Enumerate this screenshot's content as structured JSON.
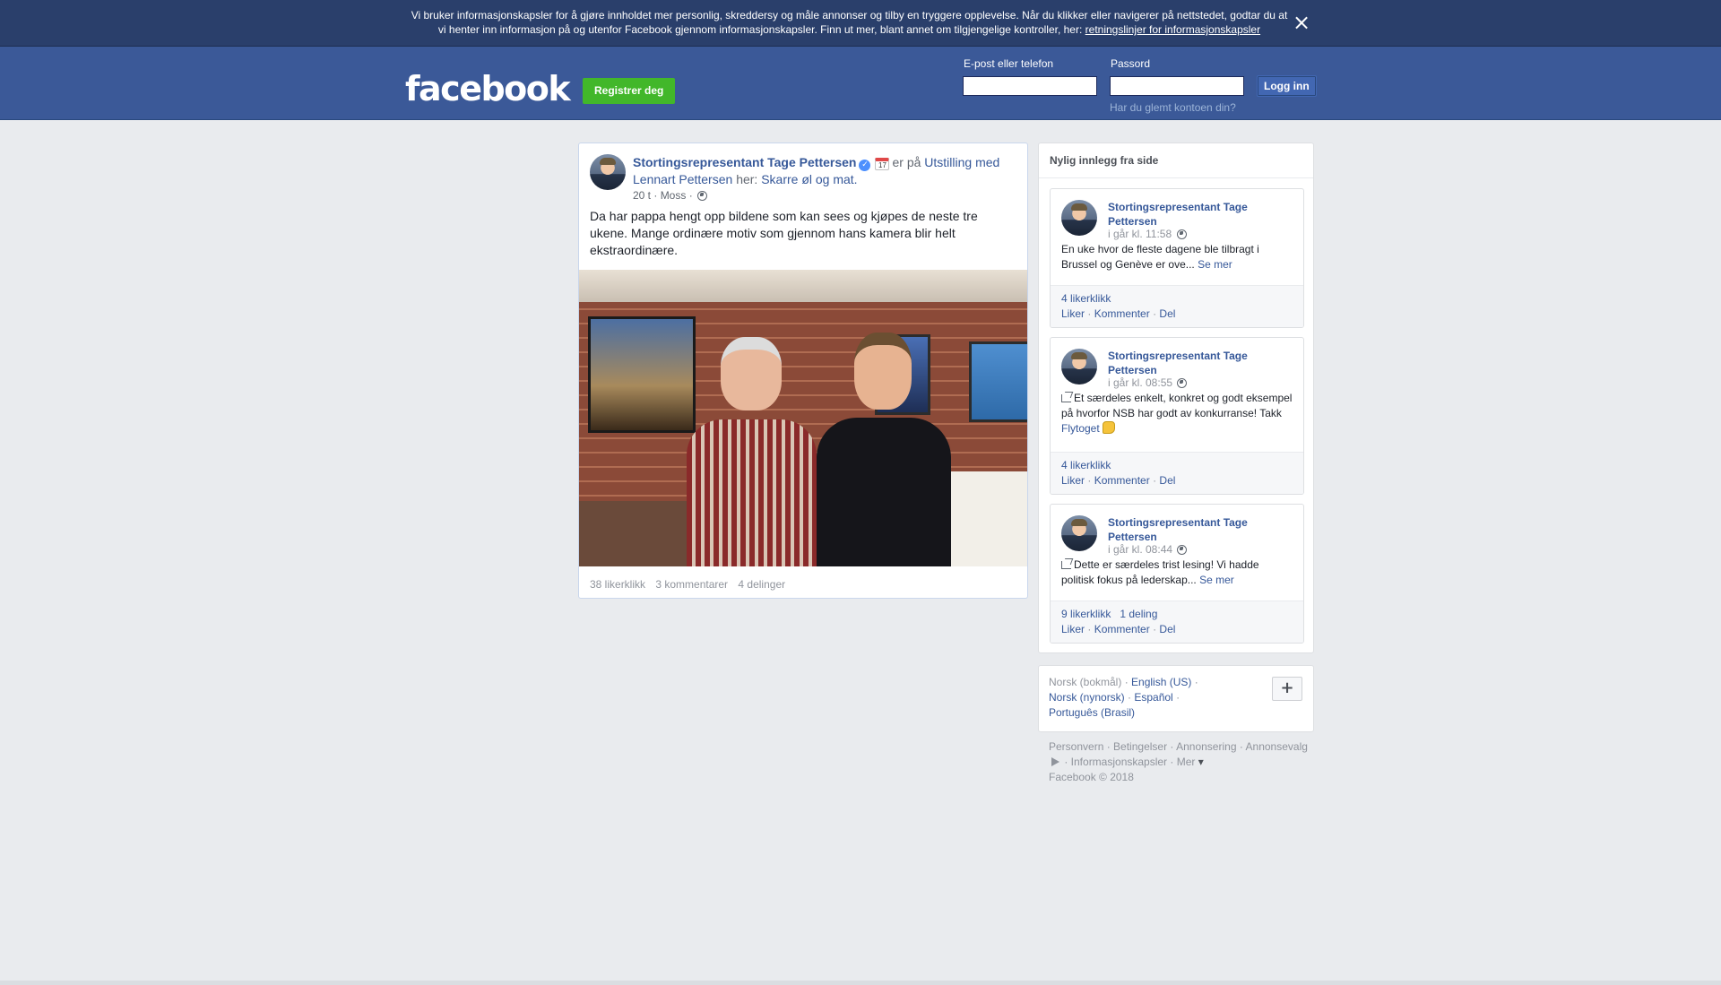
{
  "cookie_banner": {
    "text": "Vi bruker informasjonskapsler for å gjøre innholdet mer personlig, skreddersy og måle annonser og tilby en tryggere opplevelse. Når du klikker eller navigerer på nettstedet, godtar du at vi henter inn informasjon på og utenfor Facebook gjennom informasjonskapsler. Finn ut mer, blant annet om tilgjengelige kontroller, her: ",
    "link": "retningslinjer for informasjonskapsler",
    "close_icon": "close-icon"
  },
  "header": {
    "logo": "facebook",
    "register_label": "Registrer deg",
    "email_label": "E-post eller telefon",
    "email_value": "",
    "password_label": "Passord",
    "password_value": "",
    "login_label": "Logg inn",
    "forgot_label": "Har du glemt kontoen din?"
  },
  "post": {
    "author": "Stortingsrepresentant Tage Pettersen",
    "verified_icon": "verified-badge-icon",
    "calendar_icon": "calendar-icon",
    "activity_prefix": "er på",
    "event_link": "Utstilling med Lennart Pettersen",
    "place_prefix": "her:",
    "place_link": "Skarre øl og mat.",
    "time": "20 t",
    "location": "Moss",
    "privacy_icon": "globe-icon",
    "text": "Da har pappa hengt opp bildene som kan sees og kjøpes de neste tre ukene. Mange ordinære motiv som gjennom hans kamera blir helt ekstraordinære.",
    "likes": "38 likerklikk",
    "comments": "3 kommentarer",
    "shares": "4 delinger"
  },
  "sidebar": {
    "title": "Nylig innlegg fra side",
    "actions": {
      "like": "Liker",
      "comment": "Kommenter",
      "share": "Del"
    },
    "posts": [
      {
        "author": "Stortingsrepresentant Tage Pettersen",
        "time": "i går kl. 11:58",
        "text": "En uke hvor de fleste dagene ble tilbragt i Brussel og Genève er ove...",
        "see_more": "Se mer",
        "likes": "4 likerklikk"
      },
      {
        "author": "Stortingsrepresentant Tage Pettersen",
        "time": "i går kl. 08:55",
        "text": "Et særdeles enkelt, konkret og godt eksempel på hvorfor NSB har godt av konkurranse! Takk",
        "mention": "Flytoget",
        "likes": "4 likerklikk"
      },
      {
        "author": "Stortingsrepresentant Tage Pettersen",
        "time": "i går kl. 08:44",
        "text": "Dette er særdeles trist lesing! Vi hadde politisk fokus på lederskap...",
        "see_more": "Se mer",
        "likes": "9 likerklikk",
        "shares": "1 deling"
      }
    ]
  },
  "languages": {
    "current": "Norsk (bokmål)",
    "options": [
      "English (US)",
      "Norsk (nynorsk)",
      "Español",
      "Português (Brasil)"
    ],
    "more_label": "+"
  },
  "footer": {
    "links": [
      "Personvern",
      "Betingelser",
      "Annonsering",
      "Annonsevalg",
      "Informasjonskapsler",
      "Mer"
    ],
    "copyright": "Facebook © 2018"
  }
}
